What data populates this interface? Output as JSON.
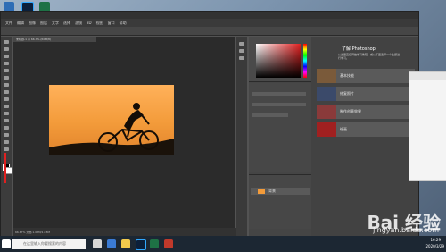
{
  "app": {
    "tabs": [
      "文件",
      "编辑",
      "图像",
      "图层",
      "文字",
      "选择",
      "滤镜",
      "3D",
      "视图",
      "窗口",
      "帮助"
    ],
    "document_tab": "未标题-1 @ 66.7% (RGB/8)",
    "status": "66.67%   文档:1.03M/1.03M"
  },
  "learn_panel": {
    "title": "了解 Photoshop",
    "description": "从这里直接开始学习教程，或从下面选择一个主题进行学习。",
    "cards": [
      {
        "label": "基本技能"
      },
      {
        "label": "修复照片"
      },
      {
        "label": "制作创意效果"
      },
      {
        "label": "绘画"
      }
    ]
  },
  "layers_panel": {
    "layer_name": "背景"
  },
  "taskbar": {
    "search_placeholder": "在这里输入你要搜索的内容",
    "time": "16:29",
    "date": "2020/3/29"
  },
  "watermark": {
    "brand": "Bai 经验",
    "url": "jingyan.baidu.com"
  },
  "colors": {
    "sunset": "#f39b3a",
    "panel_dark": "#454545"
  }
}
